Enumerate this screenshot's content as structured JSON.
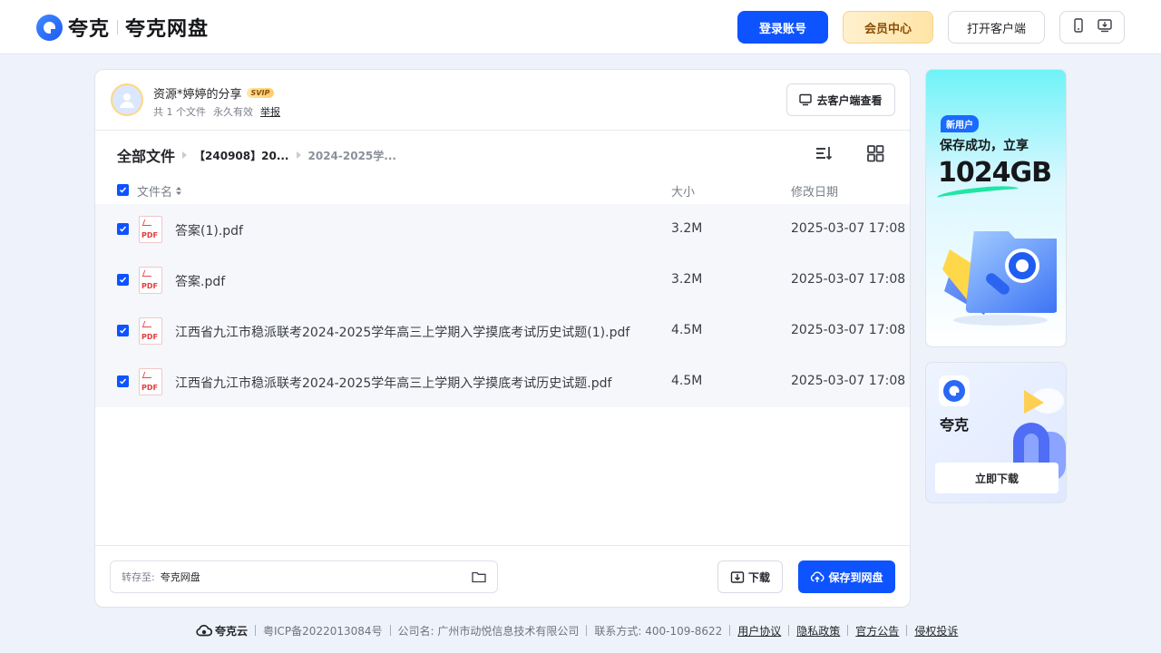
{
  "header": {
    "logo_brand": "夸克",
    "logo_product": "夸克网盘",
    "login_label": "登录账号",
    "vip_label": "会员中心",
    "client_label": "打开客户端",
    "device_icons": [
      "phone-icon",
      "desktop-download-icon"
    ]
  },
  "share": {
    "title": "资源*婷婷的分享",
    "badge": "SVIP",
    "file_count": "共 1 个文件",
    "validity": "永久有效",
    "report": "举报",
    "view_client_label": "去客户端查看"
  },
  "breadcrumb": {
    "root": "全部文件",
    "mid": "【240908】20...",
    "current": "2024-2025学..."
  },
  "table": {
    "columns": {
      "name": "文件名",
      "size": "大小",
      "date": "修改日期"
    },
    "rows": [
      {
        "name": "答案(1).pdf",
        "size": "3.2M",
        "date": "2025-03-07 17:08",
        "type": "PDF"
      },
      {
        "name": "答案.pdf",
        "size": "3.2M",
        "date": "2025-03-07 17:08",
        "type": "PDF"
      },
      {
        "name": "江西省九江市稳派联考2024-2025学年高三上学期入学摸底考试历史试题(1).pdf",
        "size": "4.5M",
        "date": "2025-03-07 17:08",
        "type": "PDF"
      },
      {
        "name": "江西省九江市稳派联考2024-2025学年高三上学期入学摸底考试历史试题.pdf",
        "size": "4.5M",
        "date": "2025-03-07 17:08",
        "type": "PDF"
      }
    ]
  },
  "bottom_bar": {
    "save_to_label": "转存至:",
    "save_to_value": "夸克网盘",
    "download_label": "下载",
    "save_label": "保存到网盘"
  },
  "ads": {
    "ad1_badge": "新用户",
    "ad1_line": "保存成功，立享",
    "ad1_big": "1024GB",
    "ad2_name": "夸克",
    "ad2_button": "立即下载"
  },
  "footer": {
    "brand": "夸克云",
    "icp": "粤ICP备2022013084号",
    "company": "公司名: 广州市动悦信息技术有限公司",
    "contact": "联系方式: 400-109-8622",
    "links": [
      "用户协议",
      "隐私政策",
      "官方公告",
      "侵权投诉"
    ]
  },
  "colors": {
    "primary": "#0d53ff",
    "vip_text": "#8b4e06",
    "pdf_red": "#e33c3c",
    "page_bg": "#eef3fb"
  }
}
